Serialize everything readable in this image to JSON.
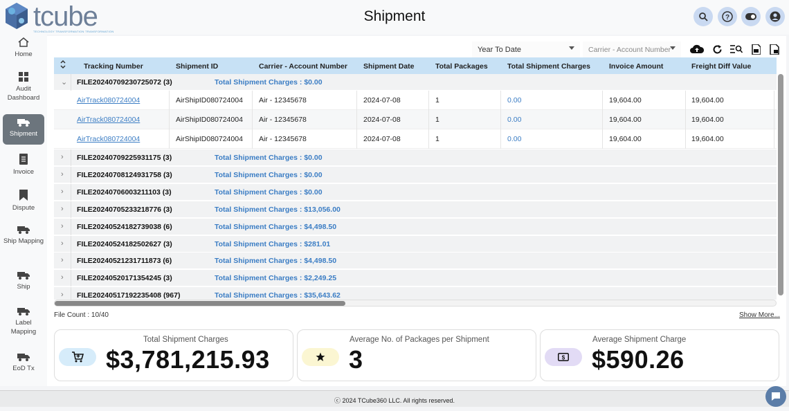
{
  "app": {
    "logo_text": "tcube",
    "logo_tagline": "TECHNOLOGY TRANSFORMATION TRANSFORMATION",
    "title": "Shipment"
  },
  "header_actions": [
    {
      "name": "search-button",
      "icon": "search-icon"
    },
    {
      "name": "help-button",
      "icon": "help-icon"
    },
    {
      "name": "toggle-button",
      "icon": "toggle-icon"
    },
    {
      "name": "user-button",
      "icon": "user-icon"
    }
  ],
  "sidebar": {
    "items": [
      {
        "label": "Home",
        "icon": "home-icon"
      },
      {
        "label": "Audit Dashboard",
        "icon": "dashboard-icon"
      },
      {
        "label": "Shipment",
        "icon": "truck-icon",
        "active": true
      },
      {
        "label": "Invoice",
        "icon": "invoice-icon"
      },
      {
        "label": "Dispute",
        "icon": "bookmark-icon"
      },
      {
        "label": "Ship Mapping",
        "icon": "truck-icon"
      },
      {
        "label": "Ship",
        "icon": "truck-icon"
      },
      {
        "label": "Label Mapping",
        "icon": "truck-icon"
      },
      {
        "label": "EoD Tx",
        "icon": "truck-icon"
      }
    ]
  },
  "filters": {
    "period": "Year To Date",
    "carrier_placeholder": "Carrier - Account Number"
  },
  "table": {
    "columns": [
      "Tracking Number",
      "Shipment ID",
      "Carrier - Account Number",
      "Shipment Date",
      "Total Packages",
      "Total Shipment Charges",
      "Invoice Amount",
      "Freight Diff Value"
    ],
    "expanded_group": {
      "file": "FILE20240709230725072 (3)",
      "total": "Total Shipment Charges : $0.00",
      "rows": [
        {
          "tracking": "AirTrack080724004",
          "shipment_id": "AirShipID080724004",
          "carrier": "Air - 12345678",
          "date": "2024-07-08",
          "packages": "1",
          "charges": "0.00",
          "invoice": "19,604.00",
          "freight_diff": "19,604.00"
        },
        {
          "tracking": "AirTrack080724004",
          "shipment_id": "AirShipID080724004",
          "carrier": "Air - 12345678",
          "date": "2024-07-08",
          "packages": "1",
          "charges": "0.00",
          "invoice": "19,604.00",
          "freight_diff": "19,604.00"
        },
        {
          "tracking": "AirTrack080724004",
          "shipment_id": "AirShipID080724004",
          "carrier": "Air - 12345678",
          "date": "2024-07-08",
          "packages": "1",
          "charges": "0.00",
          "invoice": "19,604.00",
          "freight_diff": "19,604.00"
        }
      ]
    },
    "collapsed_groups": [
      {
        "file": "FILE20240709225931175 (3)",
        "total": "Total Shipment Charges : $0.00"
      },
      {
        "file": "FILE20240708124931758 (3)",
        "total": "Total Shipment Charges : $0.00"
      },
      {
        "file": "FILE20240706003211103 (3)",
        "total": "Total Shipment Charges : $0.00"
      },
      {
        "file": "FILE20240705233218776 (3)",
        "total": "Total Shipment Charges : $13,056.00"
      },
      {
        "file": "FILE20240524182739038 (6)",
        "total": "Total Shipment Charges : $4,498.50"
      },
      {
        "file": "FILE20240524182502627 (3)",
        "total": "Total Shipment Charges : $281.01"
      },
      {
        "file": "FILE20240521231711873 (6)",
        "total": "Total Shipment Charges : $4,498.50"
      },
      {
        "file": "FILE20240520171354245 (3)",
        "total": "Total Shipment Charges : $2,249.25"
      },
      {
        "file": "FILE20240517192235408 (967)",
        "total": "Total Shipment Charges : $35,643.62"
      }
    ]
  },
  "file_count": "File Count : 10/40",
  "show_more": "Show More...",
  "stats": [
    {
      "title": "Total Shipment Charges",
      "value": "$3,781,215.93",
      "icon": "cart-icon",
      "color": "#d6ecfa"
    },
    {
      "title": "Average No. of Packages per Shipment",
      "value": "3",
      "icon": "star-icon",
      "color": "#fbf6d2"
    },
    {
      "title": "Average Shipment Charge",
      "value": "$590.26",
      "icon": "dollar-icon",
      "color": "#e2dbf5"
    }
  ],
  "footer": {
    "copyright": "ⓒ 2024 TCube360 LLC. All rights reserved."
  }
}
